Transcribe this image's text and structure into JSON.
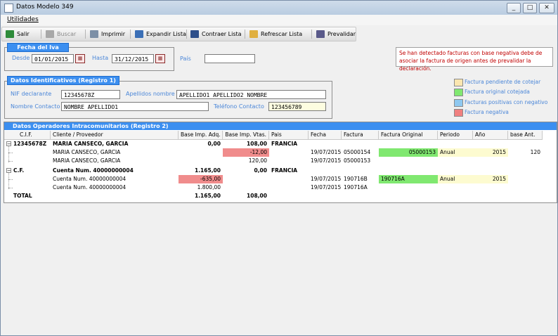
{
  "window": {
    "title": "Datos Modelo 349"
  },
  "menu": {
    "utilidades": "Utilidades"
  },
  "toolbar": {
    "salir": "Salir",
    "buscar": "Buscar",
    "imprimir": "Imprimir",
    "expandir": "Expandir Lista",
    "contraer": "Contraer Lista",
    "refrescar": "Refrescar Lista",
    "prevalidar": "Prevalidar"
  },
  "fecha": {
    "title": "Fecha del Iva",
    "desde_label": "Desde",
    "desde": "01/01/2015",
    "hasta_label": "Hasta",
    "hasta": "31/12/2015",
    "pais_label": "País",
    "pais": ""
  },
  "warning": "Se han detectado facturas con base negativa debe de asociar la factura de origen antes de prevalidar la declaración.",
  "legend": {
    "items": [
      {
        "label": "Factura pendiente de cotejar",
        "color": "#fbe6b0"
      },
      {
        "label": "Factura original cotejada",
        "color": "#80e870"
      },
      {
        "label": "Facturas positivas con negativo",
        "color": "#8ec8f0"
      },
      {
        "label": "Factura negativa",
        "color": "#f08080"
      }
    ]
  },
  "identificativos": {
    "title": "Datos Identificativos (Registro 1)",
    "nif_label": "NIF declarante",
    "nif": "12345678Z",
    "apellidos_label": "Apellidos nombre",
    "apellidos": "APELLIDO1 APELLIDO2 NOMBRE",
    "contacto_label": "Nombre Contacto",
    "contacto": "NOMBRE APELLIDO1",
    "telefono_label": "Teléfono Contacto",
    "telefono": "123456789"
  },
  "operadores": {
    "title": "Datos Operadores Intracomunitarios (Registro 2)",
    "columns": [
      "C.I.F.",
      "Cliente / Proveedor",
      "Base Imp. Adq.",
      "Base Imp. Vtas.",
      "Pais",
      "Fecha",
      "Factura",
      "Factura  Original",
      "Periodo",
      "Año",
      "base Ant."
    ],
    "rows": [
      {
        "cif": "12345678Z",
        "cliente": "MARIA CANSECO, GARCIA",
        "adq": "0,00",
        "vtas": "108,00",
        "pais": "FRANCIA",
        "fecha": "",
        "factura": "",
        "original": "",
        "periodo": "",
        "anio": "",
        "ant": ""
      },
      {
        "cif": "",
        "cliente": "MARIA CANSECO, GARCIA",
        "adq": "",
        "vtas": "-12,00",
        "pais": "",
        "fecha": "19/07/2015",
        "factura": "05000154",
        "original": "05000153",
        "periodo": "Anual",
        "anio": "2015",
        "ant": "120"
      },
      {
        "cif": "",
        "cliente": "MARIA CANSECO, GARCIA",
        "adq": "",
        "vtas": "120,00",
        "pais": "",
        "fecha": "19/07/2015",
        "factura": "05000153",
        "original": "",
        "periodo": "",
        "anio": "",
        "ant": ""
      },
      {
        "cif": "C.F.",
        "cliente": "Cuenta Num. 40000000004",
        "adq": "1.165,00",
        "vtas": "0,00",
        "pais": "FRANCIA",
        "fecha": "",
        "factura": "",
        "original": "",
        "periodo": "",
        "anio": "",
        "ant": ""
      },
      {
        "cif": "",
        "cliente": "Cuenta Num. 40000000004",
        "adq": "-635,00",
        "vtas": "",
        "pais": "",
        "fecha": "19/07/2015",
        "factura": "190716B",
        "original": "190716A",
        "periodo": "Anual",
        "anio": "2015",
        "ant": ""
      },
      {
        "cif": "",
        "cliente": "Cuenta Num. 40000000004",
        "adq": "1.800,00",
        "vtas": "",
        "pais": "",
        "fecha": "19/07/2015",
        "factura": "190716A",
        "original": "",
        "periodo": "",
        "anio": "",
        "ant": ""
      },
      {
        "cif": "TOTAL",
        "cliente": "",
        "adq": "1.165,00",
        "vtas": "108,00",
        "pais": "",
        "fecha": "",
        "factura": "",
        "original": "",
        "periodo": "",
        "anio": "",
        "ant": ""
      }
    ]
  }
}
